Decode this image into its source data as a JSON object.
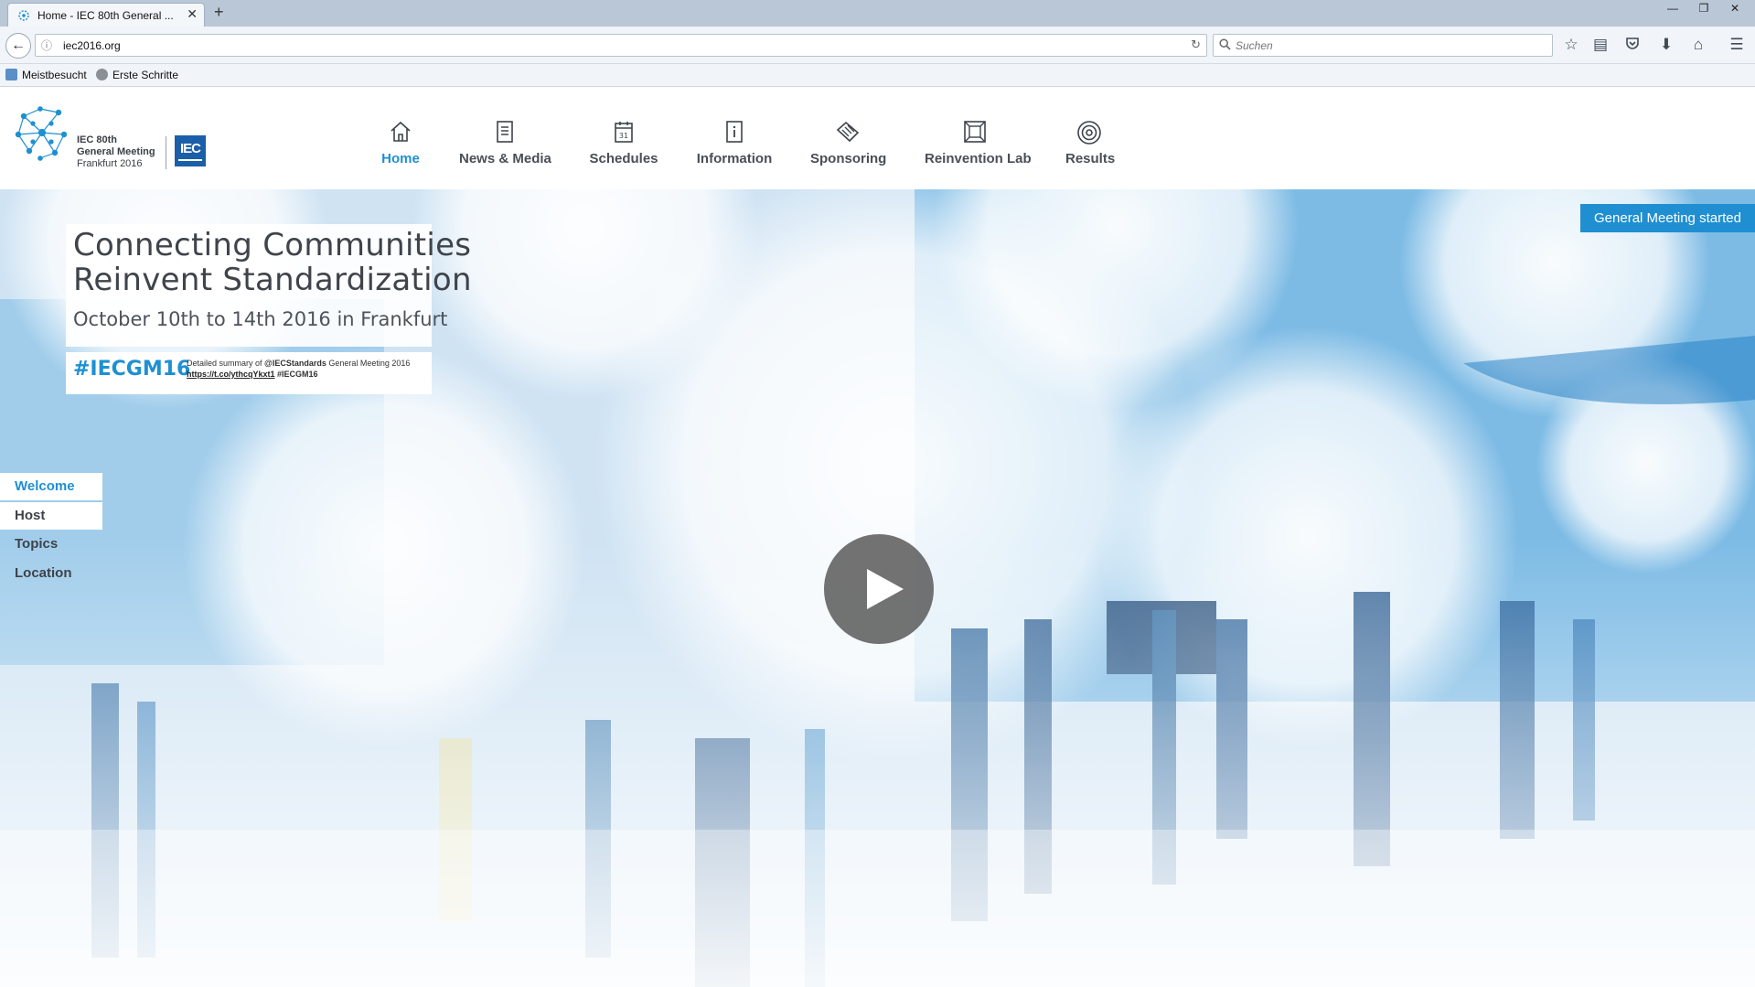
{
  "browser": {
    "tab_title": "Home - IEC 80th General ...",
    "tab_close": "✕",
    "new_tab": "+",
    "url": "iec2016.org",
    "search_placeholder": "Suchen",
    "window_controls": [
      "—",
      "❐",
      "✕"
    ],
    "bookmarks": [
      "Meistbesucht",
      "Erste Schritte"
    ],
    "toolbar_icons": [
      "star-icon",
      "reading-list-icon",
      "pocket-icon",
      "download-icon",
      "home-icon",
      "menu-icon"
    ]
  },
  "site": {
    "logo_lines": [
      "IEC 80th",
      "General Meeting",
      "Frankfurt 2016"
    ],
    "iec_badge": "IEC",
    "menu": [
      {
        "label": "Home",
        "icon": "home-icon",
        "active": true
      },
      {
        "label": "News & Media",
        "icon": "document-icon",
        "active": false
      },
      {
        "label": "Schedules",
        "icon": "calendar-icon",
        "active": false
      },
      {
        "label": "Information",
        "icon": "info-icon",
        "active": false
      },
      {
        "label": "Sponsoring",
        "icon": "handshake-icon",
        "active": false
      },
      {
        "label": "Reinvention Lab",
        "icon": "frame-icon",
        "active": false
      },
      {
        "label": "Results",
        "icon": "target-icon",
        "active": false
      }
    ]
  },
  "hero": {
    "status_badge": "General Meeting started",
    "headline_1": "Connecting Communities",
    "headline_2": "Reinvent Standardization",
    "subline": "October 10th to 14th 2016 in Frankfurt",
    "hashtag": "#IECGM16",
    "tweet_pre": "Detailed summary of",
    "tweet_handle": "@IECStandards",
    "tweet_mid": "General Meeting 2016",
    "tweet_link": "https://t.co/ythcqYkxt1",
    "tweet_tag": "#IECGM16",
    "side_nav": [
      "Welcome",
      "Host",
      "Topics",
      "Location"
    ],
    "colors": {
      "accent": "#1e90d2",
      "play_button": "#5f5f5f"
    }
  }
}
